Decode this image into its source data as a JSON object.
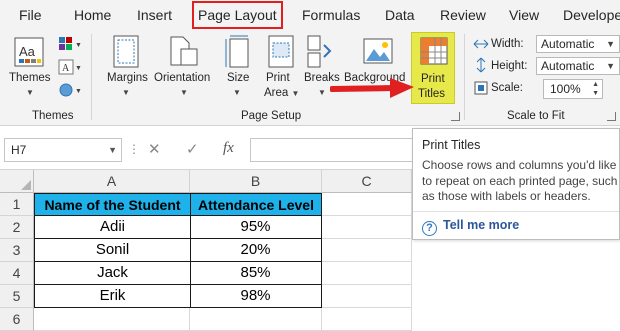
{
  "tabs": [
    "File",
    "Home",
    "Insert",
    "Page Layout",
    "Formulas",
    "Data",
    "Review",
    "View",
    "Developer"
  ],
  "ribbon": {
    "themes": {
      "themes_label": "Themes",
      "group_label": "Themes"
    },
    "page_setup": {
      "margins": "Margins",
      "orientation": "Orientation",
      "size": "Size",
      "print_area_1": "Print",
      "print_area_2": "Area",
      "breaks": "Breaks",
      "background": "Background",
      "print_titles_1": "Print",
      "print_titles_2": "Titles",
      "group_label": "Page Setup"
    },
    "scale_to_fit": {
      "width_label": "Width:",
      "width_value": "Automatic",
      "height_label": "Height:",
      "height_value": "Automatic",
      "scale_label": "Scale:",
      "scale_value": "100%",
      "group_label": "Scale to Fit"
    }
  },
  "formula_bar": {
    "name_box": "H7",
    "fx": "fx"
  },
  "grid": {
    "columns": [
      "A",
      "B",
      "C"
    ],
    "rows": [
      "1",
      "2",
      "3",
      "4",
      "5",
      "6"
    ],
    "header": [
      "Name of the Student",
      "Attendance Level"
    ],
    "data": [
      [
        "Adii",
        "95%"
      ],
      [
        "Sonil",
        "20%"
      ],
      [
        "Jack",
        "85%"
      ],
      [
        "Erik",
        "98%"
      ]
    ]
  },
  "tooltip": {
    "title": "Print Titles",
    "body": "Choose rows and columns you'd like to repeat on each printed page, such as those with labels or headers.",
    "help": "Tell me more"
  },
  "colors": {
    "header_fill": "#1fb2ea",
    "highlight": "#e7e94a",
    "annotation": "#e02020"
  }
}
